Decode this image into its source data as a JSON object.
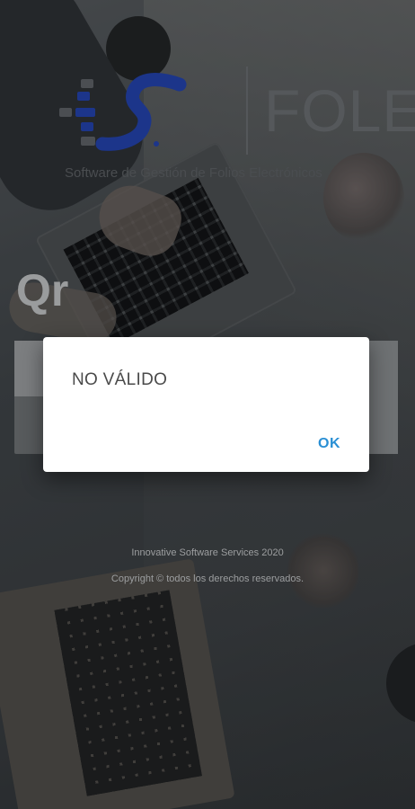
{
  "app": {
    "logo_text": "FOLE",
    "tagline": "Software de Gestión de Folios Electrónicos"
  },
  "qr": {
    "title": "Qr"
  },
  "footer": {
    "company": "Innovative Software Services 2020",
    "copyright": "Copyright © todos los derechos reservados."
  },
  "dialog": {
    "message": "NO VÁLIDO",
    "ok_label": "OK"
  },
  "colors": {
    "logo_blue": "#1f3fb0",
    "dialog_button": "#2a8fd4"
  }
}
